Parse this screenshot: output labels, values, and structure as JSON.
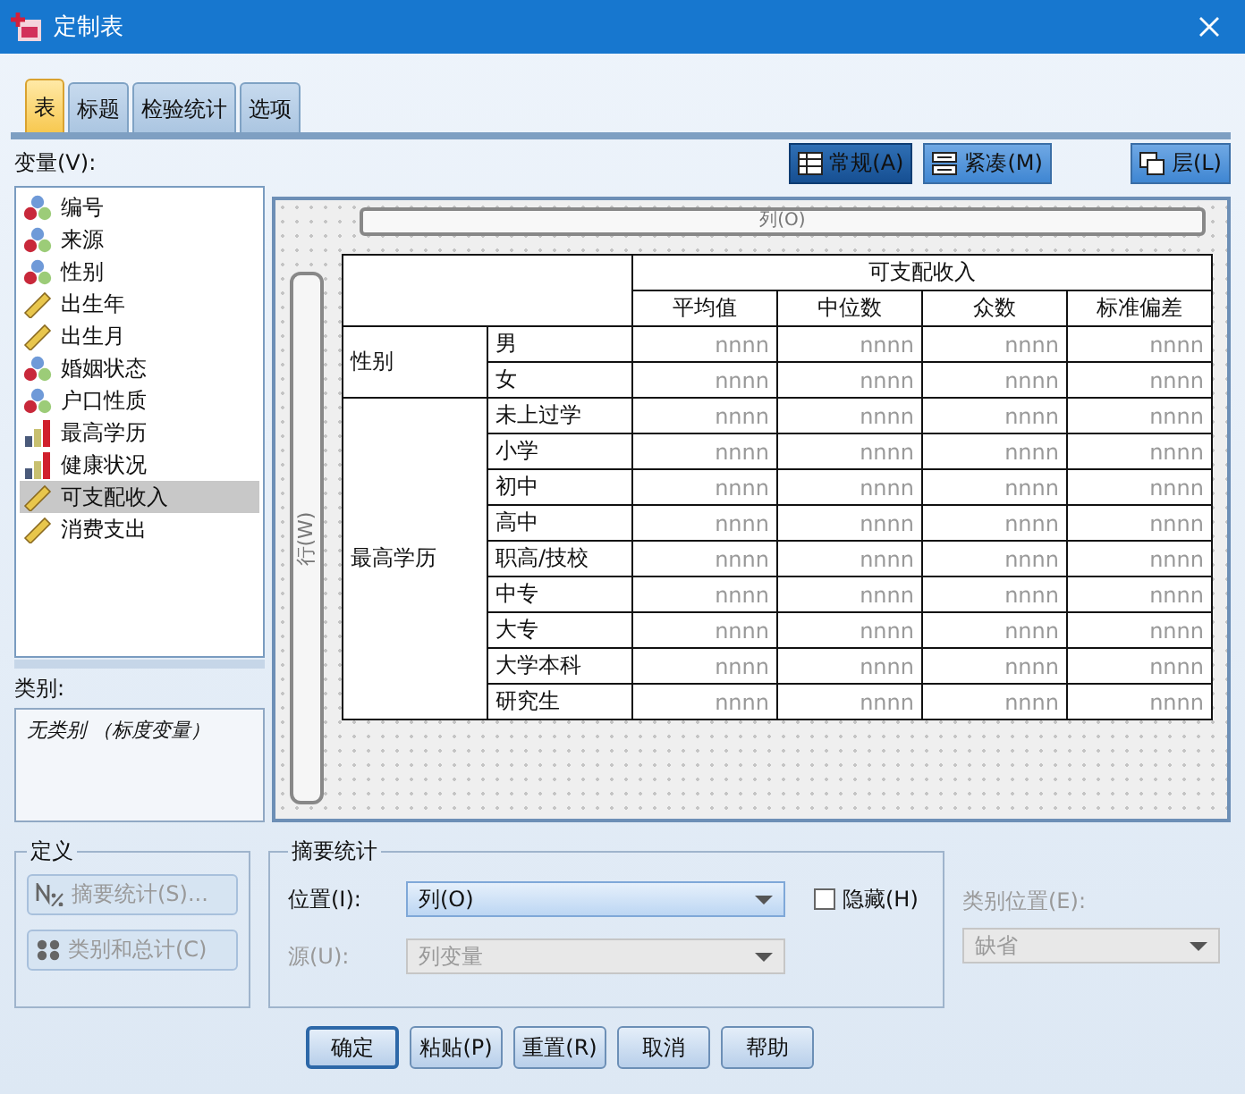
{
  "window": {
    "title": "定制表"
  },
  "tabs": [
    {
      "label": "表",
      "selected": true
    },
    {
      "label": "标题",
      "selected": false
    },
    {
      "label": "检验统计",
      "selected": false
    },
    {
      "label": "选项",
      "selected": false
    }
  ],
  "view_buttons": [
    {
      "label": "常规(A)",
      "kind": "grid",
      "selected": true
    },
    {
      "label": "紧凑(M)",
      "kind": "compact",
      "selected": false
    },
    {
      "label": "层(L)",
      "kind": "layers",
      "selected": false
    }
  ],
  "variables": {
    "label": "变量(V):",
    "items": [
      {
        "name": "编号",
        "kind": "nominal",
        "selected": false
      },
      {
        "name": "来源",
        "kind": "nominal",
        "selected": false
      },
      {
        "name": "性别",
        "kind": "nominal",
        "selected": false
      },
      {
        "name": "出生年",
        "kind": "scale",
        "selected": false
      },
      {
        "name": "出生月",
        "kind": "scale",
        "selected": false
      },
      {
        "name": "婚姻状态",
        "kind": "nominal",
        "selected": false
      },
      {
        "name": "户口性质",
        "kind": "nominal",
        "selected": false
      },
      {
        "name": "最高学历",
        "kind": "ordinal",
        "selected": false
      },
      {
        "name": "健康状况",
        "kind": "ordinal",
        "selected": false
      },
      {
        "name": "可支配收入",
        "kind": "scale",
        "selected": true
      },
      {
        "name": "消费支出",
        "kind": "scale",
        "selected": false
      }
    ]
  },
  "categories": {
    "label": "类别:",
    "text": "无类别 （标度变量）"
  },
  "canvas": {
    "column_bar": "列(O)",
    "row_bar": "行(W)",
    "table": {
      "column_variable": "可支配收入",
      "statistics": [
        "平均值",
        "中位数",
        "众数",
        "标准偏差"
      ],
      "row_groups": [
        {
          "label": "性别",
          "rows": [
            {
              "label": "男",
              "cells": [
                "nnnn",
                "nnnn",
                "nnnn",
                "nnnn"
              ]
            },
            {
              "label": "女",
              "cells": [
                "nnnn",
                "nnnn",
                "nnnn",
                "nnnn"
              ]
            }
          ]
        },
        {
          "label": "最高学历",
          "rows": [
            {
              "label": "未上过学",
              "cells": [
                "nnnn",
                "nnnn",
                "nnnn",
                "nnnn"
              ]
            },
            {
              "label": "小学",
              "cells": [
                "nnnn",
                "nnnn",
                "nnnn",
                "nnnn"
              ]
            },
            {
              "label": "初中",
              "cells": [
                "nnnn",
                "nnnn",
                "nnnn",
                "nnnn"
              ]
            },
            {
              "label": "高中",
              "cells": [
                "nnnn",
                "nnnn",
                "nnnn",
                "nnnn"
              ]
            },
            {
              "label": "职高/技校",
              "cells": [
                "nnnn",
                "nnnn",
                "nnnn",
                "nnnn"
              ]
            },
            {
              "label": "中专",
              "cells": [
                "nnnn",
                "nnnn",
                "nnnn",
                "nnnn"
              ]
            },
            {
              "label": "大专",
              "cells": [
                "nnnn",
                "nnnn",
                "nnnn",
                "nnnn"
              ]
            },
            {
              "label": "大学本科",
              "cells": [
                "nnnn",
                "nnnn",
                "nnnn",
                "nnnn"
              ]
            },
            {
              "label": "研究生",
              "cells": [
                "nnnn",
                "nnnn",
                "nnnn",
                "nnnn"
              ]
            }
          ]
        }
      ]
    }
  },
  "define": {
    "title": "定义",
    "buttons": [
      {
        "label": "摘要统计(S)...",
        "kind": "stats",
        "disabled": true
      },
      {
        "label": "类别和总计(C)",
        "kind": "cats",
        "disabled": true
      }
    ]
  },
  "summary": {
    "title": "摘要统计",
    "position": {
      "label": "位置(I):",
      "value": "列(O)",
      "disabled": false
    },
    "hide": {
      "label": "隐藏(H)",
      "checked": false
    },
    "source": {
      "label": "源(U):",
      "value": "列变量",
      "disabled": true
    }
  },
  "category_position": {
    "label": "类别位置(E):",
    "value": "缺省",
    "disabled": true
  },
  "buttons": [
    "确定",
    "粘贴(P)",
    "重置(R)",
    "取消",
    "帮助"
  ]
}
